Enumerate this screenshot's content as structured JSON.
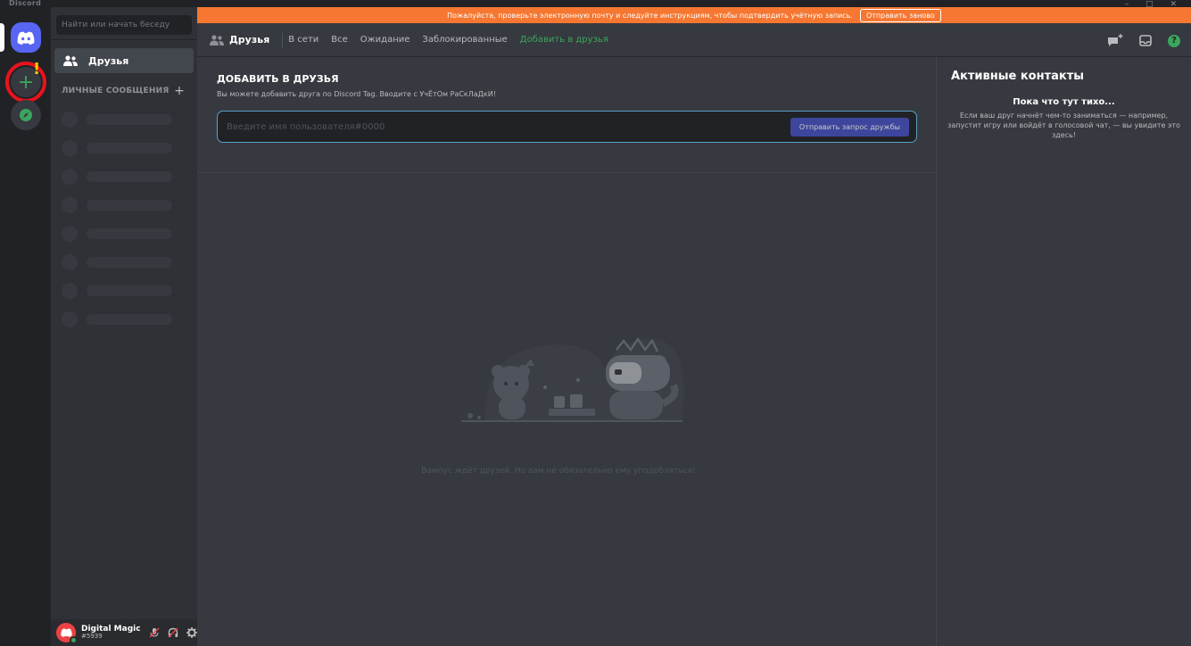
{
  "window": {
    "app_name": "Discord",
    "controls": "– □ ✕"
  },
  "verify_banner": {
    "text": "Пожалуйста, проверьте электронную почту и следуйте инструкциям, чтобы подтвердить учётную запись.",
    "button": "Отправить заново"
  },
  "sidebar": {
    "search_placeholder": "Найти или начать беседу",
    "friends_label": "Друзья",
    "dm_header": "ЛИЧНЫЕ СООБЩЕНИЯ",
    "dm_add": "+"
  },
  "user": {
    "name": "Digital Magic",
    "tag": "#5939"
  },
  "topbar": {
    "title": "Друзья",
    "tabs": [
      "В сети",
      "Все",
      "Ожидание",
      "Заблокированные"
    ],
    "add_friend": "Добавить в друзья"
  },
  "add_friend": {
    "title": "ДОБАВИТЬ В ДРУЗЬЯ",
    "description": "Вы можете добавить друга по Discord Tag. Вводите с УчЁтОм РаСкЛаДкИ!",
    "placeholder": "Введите имя пользователя#0000",
    "button": "Отправить запрос дружбы"
  },
  "empty_state": {
    "text": "Вампус ждёт друзей. Но вам не обязательно ему уподобляться!"
  },
  "active_now": {
    "title": "Активные контакты",
    "quiet_title": "Пока что тут тихо...",
    "quiet_desc": "Если ваш друг начнёт чем-то заниматься — например, запустит игру или войдёт в голосовой чат, — вы увидите это здесь!"
  },
  "colors": {
    "brand": "#5865f2",
    "green": "#3ba55d",
    "banner": "#f57731",
    "annotation": "#e8121d"
  }
}
